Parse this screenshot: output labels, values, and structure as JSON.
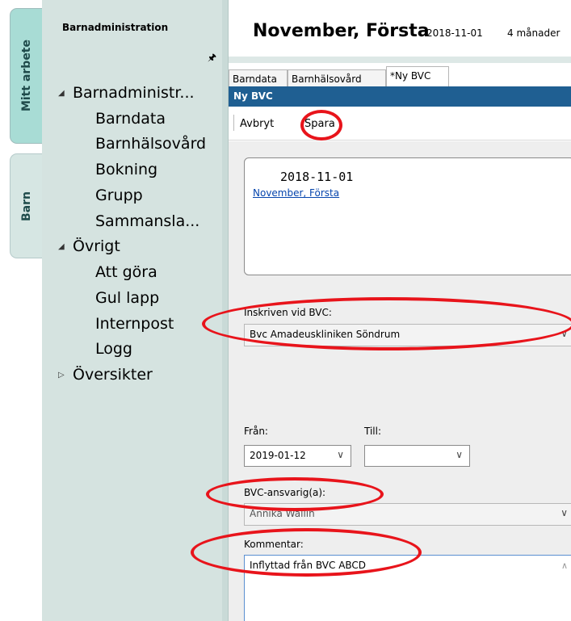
{
  "side_tabs": [
    {
      "label": "Mitt arbete"
    },
    {
      "label": "Barn"
    }
  ],
  "nav": {
    "title": "Barnadministration",
    "pin_icon": "pin-icon",
    "tree": [
      {
        "label": "Barnadministr...",
        "expanded": true
      },
      {
        "label": "Barndata"
      },
      {
        "label": "Barnhälsovård"
      },
      {
        "label": "Bokning"
      },
      {
        "label": "Grupp"
      },
      {
        "label": "Sammansla..."
      },
      {
        "label": "Övrigt",
        "expanded": true
      },
      {
        "label": "Att göra"
      },
      {
        "label": "Gul lapp"
      },
      {
        "label": "Internpost"
      },
      {
        "label": "Logg"
      },
      {
        "label": "Översikter",
        "expanded": false
      }
    ]
  },
  "header": {
    "name": "November, Första",
    "date": "2018-11-01",
    "age": "4 månader"
  },
  "tabs": [
    {
      "label": "Barndata"
    },
    {
      "label": "Barnhälsovård"
    },
    {
      "label": "*Ny BVC"
    }
  ],
  "panel": {
    "title": "Ny BVC",
    "toolbar": {
      "cancel": "Avbryt",
      "save": "Spara"
    },
    "info": {
      "date": "2018-11-01",
      "link": "November, Första"
    },
    "form": {
      "inskriven_label": "Inskriven vid BVC:",
      "inskriven_value": "Bvc Amadeuskliniken Söndrum",
      "fran_label": "Från:",
      "fran_value": "2019-01-12",
      "till_label": "Till:",
      "till_value": "",
      "ansvarig_label": "BVC-ansvarig(a):",
      "ansvarig_value": "Annika Wallin",
      "kommentar_label": "Kommentar:",
      "kommentar_value": "Inflyttad från BVC ABCD"
    }
  },
  "colors": {
    "title_bar": "#1f5f92",
    "nav_bg": "#d5e3e0",
    "annotation": "#e8141b"
  }
}
